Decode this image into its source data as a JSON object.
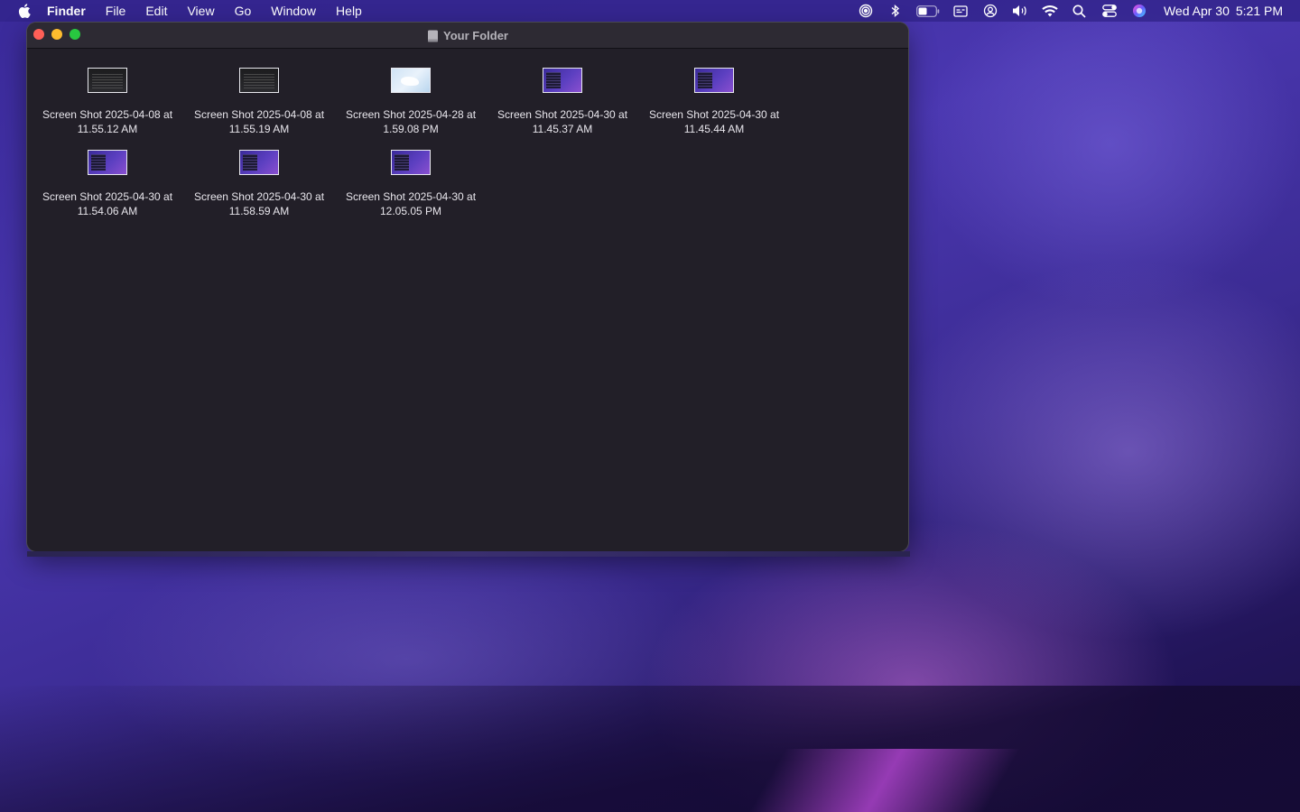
{
  "menubar": {
    "app_name": "Finder",
    "menus": [
      "File",
      "Edit",
      "View",
      "Go",
      "Window",
      "Help"
    ],
    "status_icons": [
      "airdrop-icon",
      "bluetooth-icon",
      "battery-icon",
      "display-icon",
      "user-icon",
      "volume-icon",
      "wifi-icon",
      "spotlight-search-icon",
      "control-center-icon",
      "siri-icon"
    ],
    "clock_date": "Wed Apr 30",
    "clock_time": "5:21 PM"
  },
  "window": {
    "title": "Your Folder",
    "files": [
      {
        "line1": "Screen Shot 2025-04-08 at",
        "line2": "11.55.12 AM",
        "thumb": "dark"
      },
      {
        "line1": "Screen Shot 2025-04-08 at",
        "line2": "11.55.19 AM",
        "thumb": "dark"
      },
      {
        "line1": "Screen Shot 2025-04-28 at",
        "line2": "1.59.08 PM",
        "thumb": "map"
      },
      {
        "line1": "Screen Shot 2025-04-30 at",
        "line2": "11.45.37 AM",
        "thumb": "purple"
      },
      {
        "line1": "Screen Shot 2025-04-30 at",
        "line2": "11.45.44 AM",
        "thumb": "purple"
      },
      {
        "line1": "Screen Shot 2025-04-30 at",
        "line2": "11.54.06 AM",
        "thumb": "purple"
      },
      {
        "line1": "Screen Shot 2025-04-30 at",
        "line2": "11.58.59 AM",
        "thumb": "purple"
      },
      {
        "line1": "Screen Shot 2025-04-30 at",
        "line2": "12.05.05 PM",
        "thumb": "purple"
      }
    ]
  },
  "colors": {
    "window_bg": "#221f28",
    "close": "#ff5f57",
    "minimize": "#febc2e",
    "maximize": "#28c840"
  }
}
